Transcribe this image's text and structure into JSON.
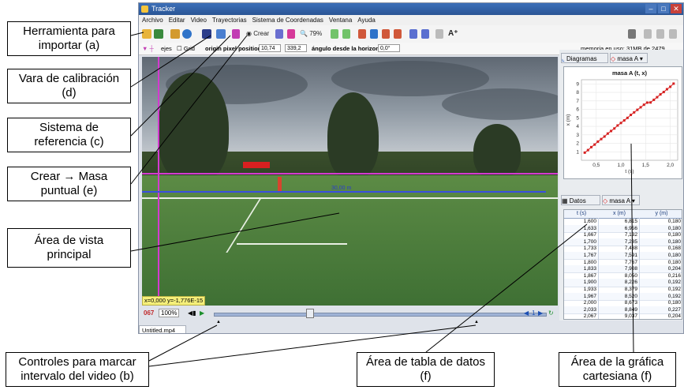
{
  "callouts": {
    "import": "Herramienta para\nimportar (a)",
    "calib": "Vara de calibración\n(d)",
    "sistema": "Sistema de\nreferencia (c)",
    "crear": "Crear → Masa\npuntual (e)",
    "vista": "Área de vista\nprincipal",
    "controles": "Controles para marcar\nintervalo del video (b)",
    "tabla": "Área de tabla de datos\n(f)",
    "grafica": "Área de la gráfica\ncartesiana (f)"
  },
  "window": {
    "title": "Tracker",
    "menu": [
      "Archivo",
      "Editar",
      "Video",
      "Trayectorias",
      "Sistema de Coordenadas",
      "Ventana",
      "Ayuda"
    ]
  },
  "toolbar": {
    "crear": "Crear",
    "zoom": "79%",
    "memory": "memoria en uso: 31MB de 2479"
  },
  "toolbar2": {
    "ejes": "ejes",
    "grid": "Grid",
    "origin_label": "origin pixel position",
    "origin_x": "10,74",
    "origin_y": "339,2",
    "angle_label": "ángulo desde la horizontal",
    "angle_value": "0,0°"
  },
  "video": {
    "coord_readout": "x=0,000  y=-1,776E-15",
    "calibration_label": "30,00 m"
  },
  "player": {
    "frame": "067",
    "rate": "100%",
    "file_tab": "Untitled.mp4",
    "end_frame": "1"
  },
  "plot": {
    "tab_label": "Diagramas",
    "track": "masa A",
    "title": "masa A (t, x)",
    "xlabel": "t (s)",
    "ylabel": "x (m)",
    "xticks": [
      "0,5",
      "1,0",
      "1,5",
      "2,0"
    ],
    "yticks": [
      "1",
      "2",
      "3",
      "4",
      "5",
      "6",
      "7",
      "8",
      "9"
    ]
  },
  "table": {
    "tab_label": "Datos",
    "track": "masa A",
    "columns": [
      "t (s)",
      "x (m)",
      "y (m)"
    ],
    "rows": [
      [
        "1,600",
        "6,815",
        "0,180"
      ],
      [
        "1,633",
        "6,956",
        "0,180"
      ],
      [
        "1,667",
        "7,132",
        "0,180"
      ],
      [
        "1,700",
        "7,285",
        "0,180"
      ],
      [
        "1,733",
        "7,438",
        "0,168"
      ],
      [
        "1,767",
        "7,591",
        "0,180"
      ],
      [
        "1,800",
        "7,767",
        "0,180"
      ],
      [
        "1,833",
        "7,908",
        "0,204"
      ],
      [
        "1,867",
        "8,050",
        "0,216"
      ],
      [
        "1,900",
        "8,226",
        "0,192"
      ],
      [
        "1,933",
        "8,379",
        "0,192"
      ],
      [
        "1,967",
        "8,520",
        "0,192"
      ],
      [
        "2,000",
        "8,673",
        "0,180"
      ],
      [
        "2,033",
        "8,849",
        "0,227"
      ],
      [
        "2,067",
        "9,037",
        "0,204"
      ]
    ]
  },
  "chart_data": {
    "type": "scatter",
    "title": "masa A (t, x)",
    "xlabel": "t (s)",
    "ylabel": "x (m)",
    "xlim": [
      0.2,
      2.15
    ],
    "ylim": [
      0,
      9.5
    ],
    "series": [
      {
        "name": "masa A",
        "x": [
          0.267,
          0.333,
          0.4,
          0.467,
          0.533,
          0.6,
          0.667,
          0.733,
          0.8,
          0.867,
          0.933,
          1.0,
          1.067,
          1.133,
          1.2,
          1.267,
          1.333,
          1.4,
          1.467,
          1.533,
          1.6,
          1.667,
          1.733,
          1.8,
          1.867,
          1.933,
          2.0,
          2.067
        ],
        "y": [
          0.9,
          1.2,
          1.55,
          1.85,
          2.2,
          2.5,
          2.8,
          3.15,
          3.45,
          3.75,
          4.1,
          4.4,
          4.7,
          5.0,
          5.35,
          5.65,
          5.95,
          6.25,
          6.55,
          6.8,
          6.82,
          7.13,
          7.44,
          7.77,
          8.05,
          8.38,
          8.67,
          9.04
        ]
      }
    ],
    "color": "#d62020",
    "grid": true
  }
}
